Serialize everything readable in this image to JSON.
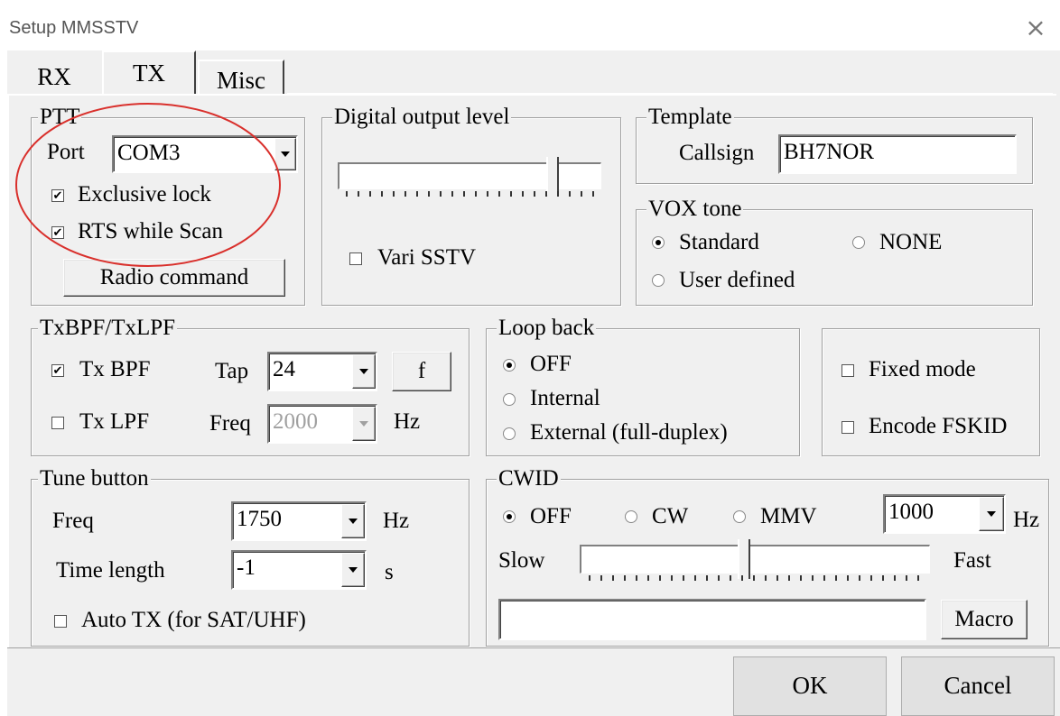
{
  "window": {
    "title": "Setup MMSSTV"
  },
  "tabs": [
    {
      "label": "RX"
    },
    {
      "label": "TX"
    },
    {
      "label": "Misc"
    }
  ],
  "ptt": {
    "legend": "PTT",
    "port_label": "Port",
    "port_value": "COM3",
    "exclusive_lock": {
      "label": "Exclusive lock",
      "checked": true
    },
    "rts_while_scan": {
      "label": "RTS while Scan",
      "checked": true
    },
    "radio_command_label": "Radio command"
  },
  "digital_output": {
    "legend": "Digital output level",
    "level_fraction": 0.82,
    "vari_sstv": {
      "label": "Vari SSTV",
      "checked": false
    }
  },
  "template": {
    "legend": "Template",
    "callsign_label": "Callsign",
    "callsign_value": "BH7NOR"
  },
  "vox_tone": {
    "legend": "VOX tone",
    "options": [
      {
        "label": "Standard",
        "selected": true
      },
      {
        "label": "NONE",
        "selected": false
      },
      {
        "label": "User defined",
        "selected": false
      }
    ]
  },
  "txbpf": {
    "legend": "TxBPF/TxLPF",
    "tx_bpf": {
      "label": "Tx BPF",
      "checked": true
    },
    "tx_lpf": {
      "label": "Tx LPF",
      "checked": false
    },
    "tap_label": "Tap",
    "tap_value": "24",
    "f_button": "f",
    "freq_label": "Freq",
    "freq_value": "2000",
    "freq_unit": "Hz"
  },
  "loop_back": {
    "legend": "Loop back",
    "options": [
      {
        "label": "OFF",
        "selected": true
      },
      {
        "label": "Internal",
        "selected": false
      },
      {
        "label": "External (full-duplex)",
        "selected": false
      }
    ]
  },
  "modes": {
    "fixed_mode": {
      "label": "Fixed mode",
      "checked": false
    },
    "encode_fskid": {
      "label": "Encode FSKID",
      "checked": false
    }
  },
  "tune": {
    "legend": "Tune button",
    "freq_label": "Freq",
    "freq_value": "1750",
    "freq_unit": "Hz",
    "time_label": "Time length",
    "time_value": "-1",
    "time_unit": "s",
    "auto_tx": {
      "label": "Auto TX (for SAT/UHF)",
      "checked": false
    }
  },
  "cwid": {
    "legend": "CWID",
    "options": [
      {
        "label": "OFF",
        "selected": true
      },
      {
        "label": "CW",
        "selected": false
      },
      {
        "label": "MMV",
        "selected": false
      }
    ],
    "freq_value": "1000",
    "freq_unit": "Hz",
    "slow_label": "Slow",
    "fast_label": "Fast",
    "speed_fraction": 0.47,
    "text_value": "",
    "macro_label": "Macro"
  },
  "buttons": {
    "ok": "OK",
    "cancel": "Cancel"
  },
  "annotation": {
    "color": "#d9302c"
  }
}
